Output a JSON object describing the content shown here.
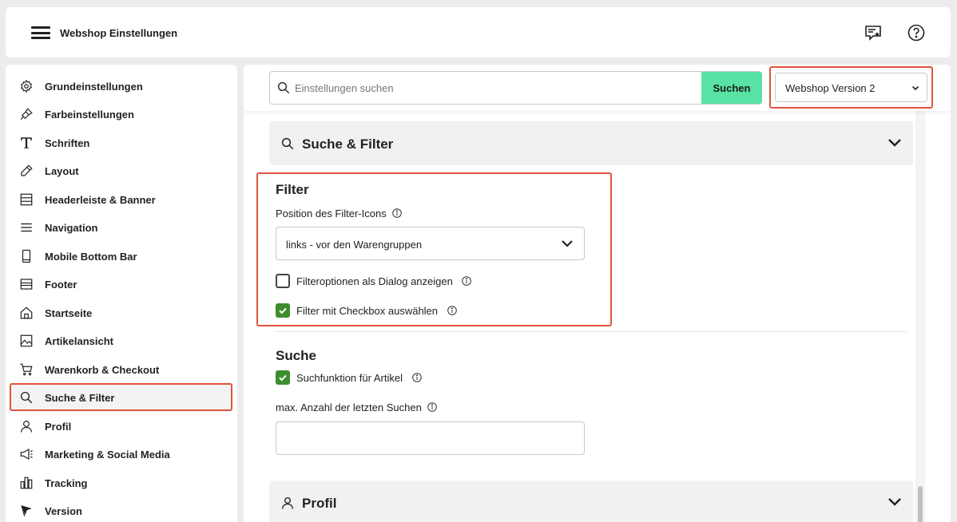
{
  "header": {
    "title": "Webshop Einstellungen",
    "icons": [
      "menu-icon",
      "feedback-icon",
      "help-icon"
    ]
  },
  "sidebar": {
    "items": [
      {
        "label": "Grundeinstellungen",
        "icon": "gear-icon"
      },
      {
        "label": "Farbeinstellungen",
        "icon": "paint-brush-icon"
      },
      {
        "label": "Schriften",
        "icon": "font-icon"
      },
      {
        "label": "Layout",
        "icon": "pencil-icon"
      },
      {
        "label": "Headerleiste & Banner",
        "icon": "header-banner-icon"
      },
      {
        "label": "Navigation",
        "icon": "navigation-icon"
      },
      {
        "label": "Mobile Bottom Bar",
        "icon": "mobile-icon"
      },
      {
        "label": "Footer",
        "icon": "footer-icon"
      },
      {
        "label": "Startseite",
        "icon": "home-icon"
      },
      {
        "label": "Artikelansicht",
        "icon": "image-icon"
      },
      {
        "label": "Warenkorb & Checkout",
        "icon": "cart-icon"
      },
      {
        "label": "Suche & Filter",
        "icon": "search-icon",
        "active": true
      },
      {
        "label": "Profil",
        "icon": "user-icon"
      },
      {
        "label": "Marketing & Social Media",
        "icon": "megaphone-icon"
      },
      {
        "label": "Tracking",
        "icon": "bar-chart-icon"
      },
      {
        "label": "Version",
        "icon": "flag-icon"
      }
    ]
  },
  "search": {
    "placeholder": "Einstellungen suchen",
    "value": "",
    "button_label": "Suchen"
  },
  "version_select": {
    "value": "Webshop Version 2"
  },
  "sections": {
    "suche_filter": {
      "title": "Suche & Filter",
      "filter": {
        "title": "Filter",
        "position_label": "Position des Filter-Icons",
        "position_value": "links - vor den Warengruppen",
        "dialog_label": "Filteroptionen als Dialog anzeigen",
        "dialog_checked": false,
        "checkbox_label": "Filter mit Checkbox auswählen",
        "checkbox_checked": true
      },
      "suche": {
        "title": "Suche",
        "suchfunktion_label": "Suchfunktion für Artikel",
        "suchfunktion_checked": true,
        "max_label": "max. Anzahl der letzten Suchen",
        "max_value": ""
      }
    },
    "profil": {
      "title": "Profil"
    }
  },
  "colors": {
    "accent_green": "#58e2a5",
    "checkbox_green": "#3e8e2e",
    "highlight_red": "#e0533d"
  }
}
